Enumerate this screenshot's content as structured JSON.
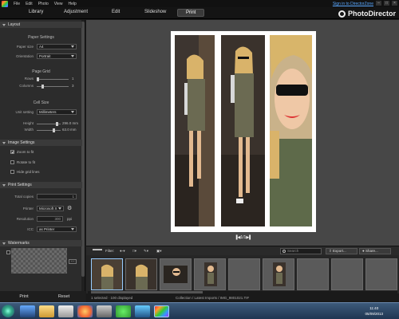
{
  "menu": {
    "items": [
      "File",
      "Edit",
      "Photo",
      "View",
      "Help"
    ],
    "signin": "Sign in to DirectorZone",
    "window_controls": [
      "–",
      "□",
      "×"
    ]
  },
  "tabs": {
    "library": "Library",
    "adjustment": "Adjustment",
    "edit": "Edit",
    "slideshow": "Slideshow",
    "print": "Print"
  },
  "brand": {
    "name": "PhotoDirector"
  },
  "layout": {
    "header": "Layout",
    "paper_settings": "Paper Settings",
    "paper_size_label": "Paper size",
    "paper_size_value": "A4",
    "orientation_label": "Orientation",
    "orientation_value": "Portrait",
    "page_grid": "Page Grid",
    "rows_label": "Rows",
    "rows_value": "1",
    "columns_label": "Columns",
    "columns_value": "3",
    "cell_size": "Cell Size",
    "unit_label": "Unit setting",
    "unit_value": "Millimeters",
    "height_label": "Height",
    "height_value": "296.0 mm",
    "width_label": "Width",
    "width_value": "63.0 mm"
  },
  "image_settings": {
    "header": "Image Settings",
    "zoom_to_fit": "Zoom to fit",
    "rotate_to_fit": "Rotate to fit",
    "hide_grid_lines": "Hide grid lines"
  },
  "print_settings": {
    "header": "Print Settings",
    "total_copies_label": "Total copies",
    "total_copies_value": "1",
    "printer_label": "Printer",
    "printer_value": "Microsoft X",
    "resolution_label": "Resolution",
    "resolution_value": "300",
    "resolution_unit": "ppi",
    "icc_label": "ICC",
    "icc_value": "as Printer"
  },
  "watermarks": {
    "header": "Watermarks",
    "add_watermark": "Add watermark",
    "more_button": "..."
  },
  "bottom": {
    "print": "Print",
    "reset": "Reset"
  },
  "page_nav": "1/1",
  "filterbar": {
    "filter_label": "Filter:",
    "search_placeholder": "Search",
    "export": "Export...",
    "share": "Share..."
  },
  "status": {
    "left": "1 selected · 100 displayed",
    "right": "Collection / Latest Imports / IMG_9801021.TIF"
  },
  "taskbar": {
    "time": "11:40",
    "date": "05/09/2013"
  }
}
